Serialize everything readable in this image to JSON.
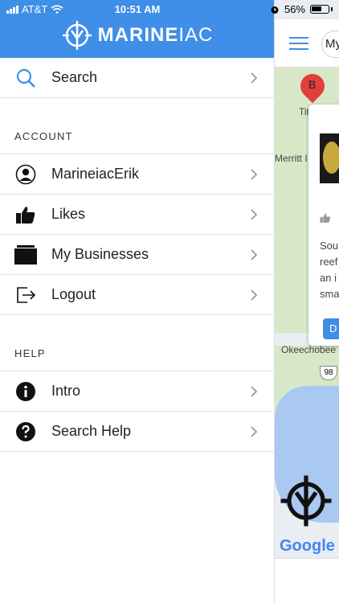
{
  "status": {
    "carrier": "AT&T",
    "time": "10:51 AM",
    "battery": "56%"
  },
  "header": {
    "logo_bold": "MARINE",
    "logo_light": "IAC"
  },
  "search": {
    "label": "Search"
  },
  "account": {
    "title": "ACCOUNT",
    "items": [
      {
        "label": "MarineiacErik",
        "icon": "user-icon"
      },
      {
        "label": "Likes",
        "icon": "thumbs-up-icon"
      },
      {
        "label": "My Businesses",
        "icon": "folder-icon"
      },
      {
        "label": "Logout",
        "icon": "logout-icon"
      }
    ]
  },
  "help": {
    "title": "HELP",
    "items": [
      {
        "label": "Intro",
        "icon": "info-icon"
      },
      {
        "label": "Search Help",
        "icon": "question-icon"
      }
    ]
  },
  "map": {
    "pill_text": "My",
    "pin_label": "B",
    "place_1": "Titu",
    "place_2": "Merritt I",
    "place_3": "Okeechobee",
    "route_1": "98",
    "card_text_1": "Sou",
    "card_text_2": "reef",
    "card_text_3": "an i",
    "card_text_4": "sma",
    "card_button": "D",
    "google": "Google"
  },
  "colors": {
    "accent": "#3f8ee8",
    "pin": "#e23e3b"
  }
}
